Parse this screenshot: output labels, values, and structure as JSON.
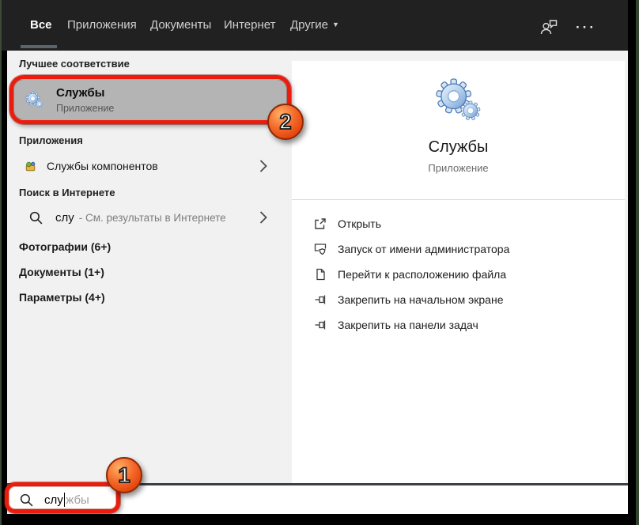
{
  "topbar": {
    "tabs": [
      {
        "label": "Все",
        "active": true
      },
      {
        "label": "Приложения",
        "active": false
      },
      {
        "label": "Документы",
        "active": false
      },
      {
        "label": "Интернет",
        "active": false
      },
      {
        "label": "Другие",
        "active": false
      }
    ],
    "dropdown_arrow": "▼",
    "ellipsis": "···"
  },
  "left_panel": {
    "best_match_header": "Лучшее соответствие",
    "best_match": {
      "title": "Службы",
      "subtitle": "Приложение"
    },
    "apps_header": "Приложения",
    "apps_item": {
      "label": "Службы компонентов"
    },
    "web_header": "Поиск в Интернете",
    "web_item": {
      "query": "слу",
      "suffix": "- См. результаты в Интернете"
    },
    "groups": [
      {
        "label": "Фотографии (6+)"
      },
      {
        "label": "Документы (1+)"
      },
      {
        "label": "Параметры (4+)"
      }
    ]
  },
  "preview_panel": {
    "title": "Службы",
    "subtitle": "Приложение",
    "actions": [
      {
        "label": "Открыть"
      },
      {
        "label": "Запуск от имени администратора"
      },
      {
        "label": "Перейти к расположению файла"
      },
      {
        "label": "Закрепить на начальном экране"
      },
      {
        "label": "Закрепить на панели задач"
      }
    ]
  },
  "search_bar": {
    "typed": "слу",
    "suggestion": "жбы"
  },
  "annotations": {
    "step1": "1",
    "step2": "2",
    "highlight_color": "#ed1b0b",
    "badge_color": "#f1570f"
  }
}
